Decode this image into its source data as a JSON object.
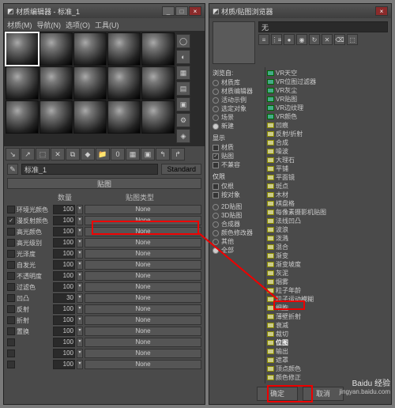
{
  "leftWindow": {
    "title": "材质编辑器 - 标准_1",
    "menu": [
      "材质(M)",
      "导航(N)",
      "选项(O)",
      "工具(U)"
    ],
    "materialName": "标准_1",
    "materialType": "Standard",
    "rolloutTitle": "贴图",
    "colAmount": "数量",
    "colType": "贴图类型",
    "none": "None",
    "maps": [
      {
        "label": "环境光颜色",
        "amount": "100",
        "checked": false
      },
      {
        "label": "漫反射颜色",
        "amount": "100",
        "checked": true
      },
      {
        "label": "高光颜色",
        "amount": "100",
        "checked": false
      },
      {
        "label": "高光级别",
        "amount": "100",
        "checked": false
      },
      {
        "label": "光泽度",
        "amount": "100",
        "checked": false
      },
      {
        "label": "自发光",
        "amount": "100",
        "checked": false
      },
      {
        "label": "不透明度",
        "amount": "100",
        "checked": false
      },
      {
        "label": "过滤色",
        "amount": "100",
        "checked": false
      },
      {
        "label": "凹凸",
        "amount": "30",
        "checked": false
      },
      {
        "label": "反射",
        "amount": "100",
        "checked": false
      },
      {
        "label": "折射",
        "amount": "100",
        "checked": false
      },
      {
        "label": "置换",
        "amount": "100",
        "checked": false
      },
      {
        "label": "",
        "amount": "100",
        "checked": false
      },
      {
        "label": "",
        "amount": "100",
        "checked": false
      },
      {
        "label": "",
        "amount": "100",
        "checked": false
      }
    ]
  },
  "rightWindow": {
    "title": "材质/贴图浏览器",
    "selectedName": "无",
    "browseFrom": {
      "title": "浏览自:",
      "items": [
        "材质库",
        "材质编辑器",
        "活动示例",
        "选定对象",
        "场景",
        "新建"
      ]
    },
    "show": {
      "title": "显示",
      "items": [
        {
          "l": "材质",
          "c": false
        },
        {
          "l": "贴图",
          "c": true
        },
        {
          "l": "不兼容",
          "c": false
        }
      ]
    },
    "only": {
      "title": "仅限",
      "items": [
        {
          "l": "仅根",
          "c": false
        },
        {
          "l": "按对象",
          "c": false
        }
      ]
    },
    "categories": {
      "items": [
        {
          "l": "2D贴图",
          "c": false
        },
        {
          "l": "3D贴图",
          "c": false
        },
        {
          "l": "合成器",
          "c": false
        },
        {
          "l": "颜色修改器",
          "c": false
        },
        {
          "l": "其他",
          "c": false
        },
        {
          "l": "全部",
          "c": true
        }
      ]
    },
    "tree": [
      "VR天空",
      "VR位图过滤器",
      "VR灰尘",
      "VR贴图",
      "VR边纹理",
      "VR颜色",
      "凹痕",
      "反射/折射",
      "合成",
      "噪波",
      "大理石",
      "平铺",
      "平面镜",
      "斑点",
      "木材",
      "棋盘格",
      "每像素摄影机贴图",
      "法线凹凸",
      "波浪",
      "泼溅",
      "混合",
      "渐变",
      "渐变坡度",
      "灰泥",
      "烟雾",
      "粒子年龄",
      "粒子运动模糊",
      "细胞",
      "薄壁折射",
      "衰减",
      "裁切",
      "位图",
      "输出",
      "遮罩",
      "顶点颜色",
      "颜色修正"
    ],
    "highlightedItem": "位图",
    "okBtn": "确定",
    "cancelBtn": "取消"
  },
  "watermark": {
    "brand": "Baidu 经验",
    "url": "jingyan.baidu.com"
  }
}
